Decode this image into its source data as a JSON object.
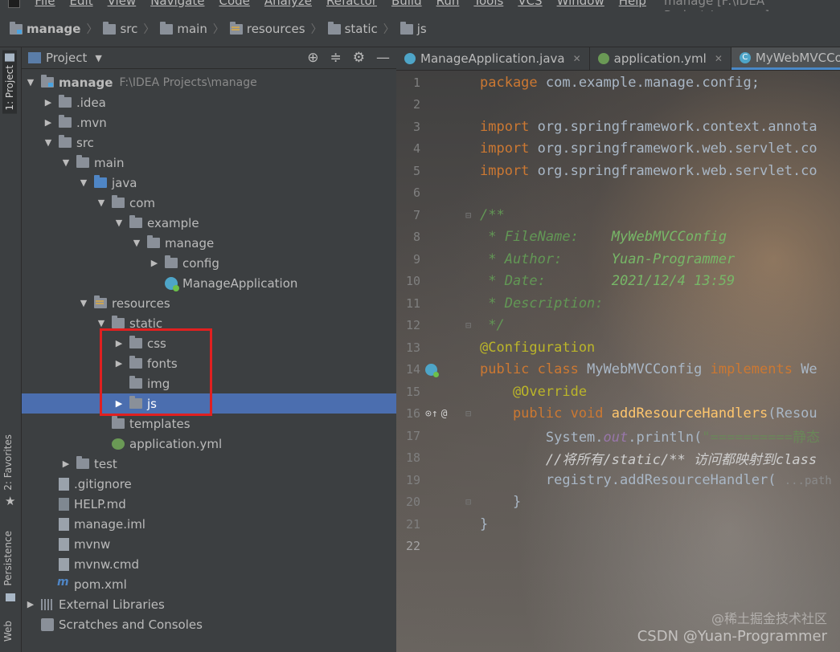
{
  "menubar": {
    "items": [
      "File",
      "Edit",
      "View",
      "Navigate",
      "Code",
      "Analyze",
      "Refactor",
      "Build",
      "Run",
      "Tools",
      "VCS",
      "Window",
      "Help"
    ],
    "window_title": "manage [F:\\IDEA Projects\\manage]"
  },
  "breadcrumb": [
    "manage",
    "src",
    "main",
    "resources",
    "static",
    "js"
  ],
  "left_strip": {
    "project_tab": "1: Project",
    "favorites_tab": "2: Favorites",
    "persistence_tab": "Persistence",
    "web_tab": "Web"
  },
  "project_panel": {
    "title": "Project"
  },
  "tree": [
    {
      "label": "manage",
      "hint": "F:\\IDEA Projects\\manage"
    },
    {
      "label": ".idea"
    },
    {
      "label": ".mvn"
    },
    {
      "label": "src"
    },
    {
      "label": "main"
    },
    {
      "label": "java"
    },
    {
      "label": "com"
    },
    {
      "label": "example"
    },
    {
      "label": "manage"
    },
    {
      "label": "config"
    },
    {
      "label": "ManageApplication"
    },
    {
      "label": "resources"
    },
    {
      "label": "static"
    },
    {
      "label": "css"
    },
    {
      "label": "fonts"
    },
    {
      "label": "img"
    },
    {
      "label": "js"
    },
    {
      "label": "templates"
    },
    {
      "label": "application.yml"
    },
    {
      "label": "test"
    },
    {
      "label": ".gitignore"
    },
    {
      "label": "HELP.md"
    },
    {
      "label": "manage.iml"
    },
    {
      "label": "mvnw"
    },
    {
      "label": "mvnw.cmd"
    },
    {
      "label": "pom.xml"
    },
    {
      "label": "External Libraries"
    },
    {
      "label": "Scratches and Consoles"
    }
  ],
  "tabs": [
    {
      "label": "ManageApplication.java"
    },
    {
      "label": "application.yml"
    },
    {
      "label": "MyWebMVCConfig"
    }
  ],
  "code": {
    "l1_kw": "package",
    "l1_rest": " com.example.manage.config;",
    "l3_kw": "import",
    "l3_rest": " org.springframework.context.annota",
    "l4_kw": "import",
    "l4_rest": " org.springframework.web.servlet.co",
    "l5_kw": "import",
    "l5_rest": " org.springframework.web.servlet.co",
    "l7": "/**",
    "l8_tag": " * FileName:",
    "l8_val": "    MyWebMVCConfig",
    "l9_tag": " * Author:",
    "l9_val": "      Yuan-Programmer",
    "l10_tag": " * Date:",
    "l10_val": "        2021/12/4 13:59",
    "l11_tag": " * Description:",
    "l12": " */",
    "l13": "@Configuration",
    "l14_kw": "public class",
    "l14_name": " MyWebMVCConfig ",
    "l14_impl": "implements",
    "l14_rest": " We",
    "l15": "    @Override",
    "l16_kw": "    public void",
    "l16_fn": " addResourceHandlers",
    "l16_rest": "(Resou",
    "l17_a": "        System.",
    "l17_fld": "out",
    "l17_b": ".println(",
    "l17_str": "\"==========静态",
    "l18": "        //将所有/static/** 访问都映射到class",
    "l19_a": "        registry.addResourceHandler( ",
    "l19_hint": "...path",
    "l20": "    }",
    "l21": "}",
    "gutter_16": "@"
  },
  "line_numbers": [
    "1",
    "2",
    "3",
    "4",
    "5",
    "6",
    "7",
    "8",
    "9",
    "10",
    "11",
    "12",
    "13",
    "14",
    "15",
    "16",
    "17",
    "18",
    "19",
    "20",
    "21",
    "22"
  ],
  "watermark": {
    "line1": "@稀土掘金技术社区",
    "line2": "CSDN @Yuan-Programmer"
  },
  "colors": {
    "selection": "#4b6eaf",
    "highlight_box": "#e02020",
    "keyword": "#cc7832",
    "annotation": "#bbb529"
  }
}
